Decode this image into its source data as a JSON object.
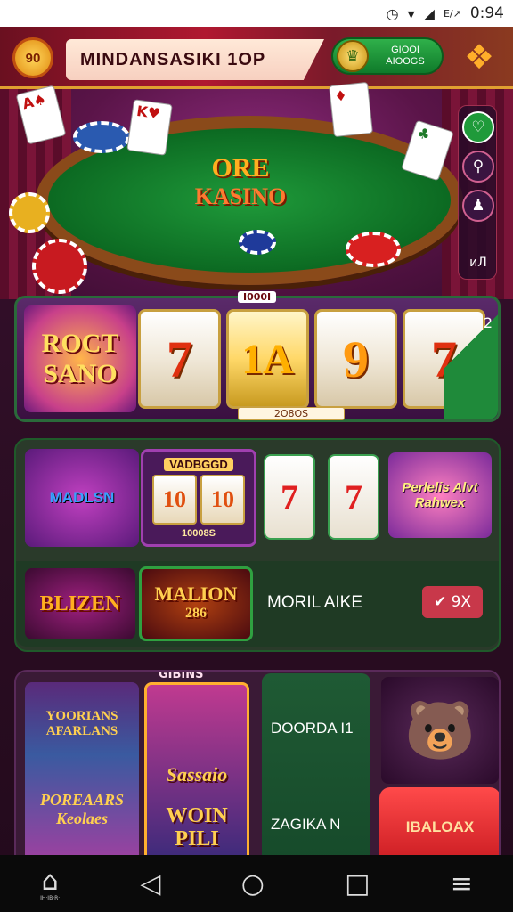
{
  "status_bar": {
    "battery": "E/↗",
    "time": "0:94"
  },
  "header": {
    "logo": "90",
    "title": "MINDANSASIKI  1OP",
    "balance_line1": "GIOOI",
    "balance_line2": "AIOOGS"
  },
  "hero": {
    "table_line1": "ORE",
    "table_line2": "KASINO",
    "side_bottom": "иЛ"
  },
  "slot": {
    "tag": "I000I",
    "logo_line1": "ROCT",
    "logo_line2": "SANO",
    "reels": [
      "7",
      "1A",
      "9",
      "7"
    ],
    "reel_sub": "2O8OS",
    "corner": "2"
  },
  "games1": {
    "magician": "MADLSN",
    "mini_top": "VADBGGD",
    "mini_cells": [
      "10",
      "10"
    ],
    "mini_bottom": "10008S",
    "reel7a": "7",
    "reel7b": "7",
    "pearl": "Perlelis Alvt Rahwex",
    "blaze": "BLIZEN",
    "million_1": "MALION",
    "million_2": "286",
    "more_like": "MORIL AIKE",
    "pill": "✔ 9X"
  },
  "games2": {
    "label": "GIBINS",
    "yord_1": "YOORIANS AFARLANS",
    "yord_2": "POREAARS Keolaes",
    "sassy_1": "Sassaio",
    "sassy_2": "WOIN PILI",
    "green_1": "DOORDA I1",
    "green_2": "ZAGIKA N",
    "red_button": "IBALOAX"
  },
  "nav": {
    "home_small": "IH·IB·R·"
  },
  "colors": {
    "accent": "#b01830",
    "gold": "#ffb020",
    "felt": "#1f9a3a"
  }
}
